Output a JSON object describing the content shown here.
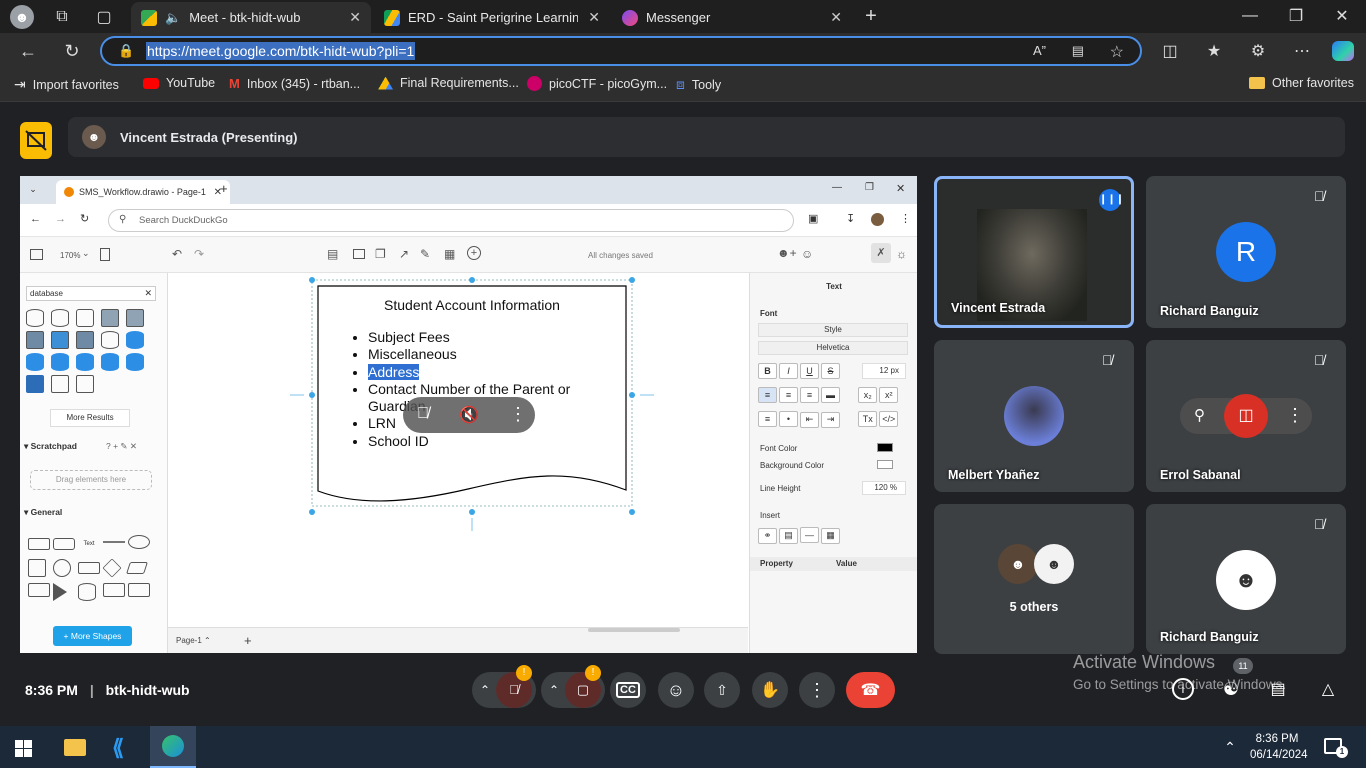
{
  "browser": {
    "tabs": [
      {
        "title": "Meet - btk-hidt-wub",
        "active": true
      },
      {
        "title": "ERD - Saint Perigrine Learning Ce",
        "active": false
      },
      {
        "title": "Messenger",
        "active": false
      }
    ],
    "url_selected": "https://meet.google.com/btk-hidt-wub?pli=1",
    "bookmarks": [
      {
        "label": "Import favorites",
        "icon": "import-icon"
      },
      {
        "label": "YouTube",
        "icon": "youtube-icon"
      },
      {
        "label": "Inbox (345) - rtban...",
        "icon": "gmail-icon"
      },
      {
        "label": "Final Requirements...",
        "icon": "drive-icon"
      },
      {
        "label": "picoCTF - picoGym...",
        "icon": "picoctf-icon"
      },
      {
        "label": "Tooly",
        "icon": "tooly-icon"
      }
    ],
    "other_favorites": "Other favorites"
  },
  "meet": {
    "presenter_label": "Vincent Estrada (Presenting)",
    "time": "8:36 PM",
    "meeting_code": "btk-hidt-wub",
    "participant_count": "11",
    "participants": [
      {
        "name": "Vincent Estrada",
        "speaking": true
      },
      {
        "name": "Richard Banguiz",
        "initial": "R",
        "muted": true
      },
      {
        "name": "Melbert Ybañez",
        "muted": true
      },
      {
        "name": "Errol Sabanal",
        "muted": true
      },
      {
        "name": "5 others"
      },
      {
        "name": "Richard Banguiz",
        "muted": true
      }
    ],
    "watermark_title": "Activate Windows",
    "watermark_sub": "Go to Settings to activate Windows."
  },
  "shared": {
    "tab_title": "SMS_Workflow.drawio - Page-1",
    "search_placeholder": "Search DuckDuckGo",
    "zoom": "170%",
    "save_status": "All changes saved",
    "left_search": "database",
    "more_results": "More Results",
    "scratchpad": "Scratchpad",
    "drag_here": "Drag elements here",
    "general": "General",
    "text_label": "Text",
    "more_shapes": "+ More Shapes",
    "page_tab": "Page-1",
    "panel_title": "Text",
    "font_section": "Font",
    "style_select": "Style",
    "font_select": "Helvetica",
    "font_size": "12 px",
    "font_color": "Font Color",
    "background_color": "Background Color",
    "line_height": "Line Height",
    "line_height_val": "120 %",
    "insert": "Insert",
    "property": "Property",
    "value": "Value",
    "doc_title": "Student Account Information",
    "doc_items": [
      "Subject Fees",
      "Miscellaneous",
      "Address",
      "Contact Number of the Parent or Guardian",
      "LRN",
      "School ID"
    ]
  },
  "taskbar": {
    "time": "8:36 PM",
    "date": "06/14/2024",
    "notif_count": "1"
  },
  "colors": {
    "accent": "#1a73e8",
    "end_call": "#ea4335",
    "present": "#fbbc04",
    "tile": "#3c4043"
  }
}
